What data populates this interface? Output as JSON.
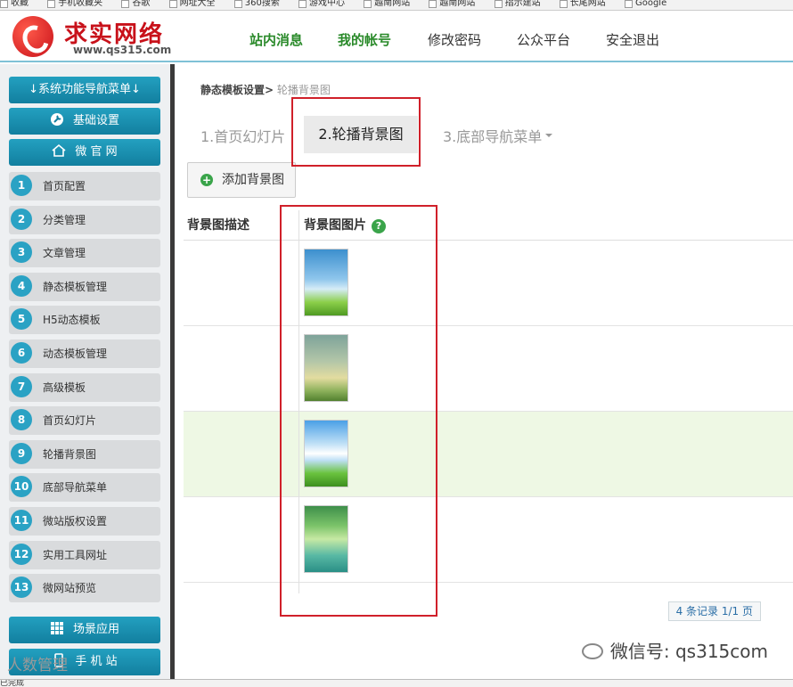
{
  "bookmarks": [
    "收藏",
    "手机收藏夹",
    "谷歌",
    "网址大全",
    "360搜索",
    "游戏中心",
    "越南网站",
    "越南网站",
    "指示建站",
    "长尾网站",
    "Google"
  ],
  "logo": {
    "name": "求实网络",
    "url": "www.qs315.com"
  },
  "topnav": [
    "站内消息",
    "我的帐号",
    "修改密码",
    "公众平台",
    "安全退出"
  ],
  "sidebar": {
    "menu_toggle": "↓系统功能导航菜单↓",
    "basic": "基础设置",
    "weiguanwang": "微 官 网",
    "items": [
      {
        "num": "1",
        "label": "首页配置"
      },
      {
        "num": "2",
        "label": "分类管理"
      },
      {
        "num": "3",
        "label": "文章管理"
      },
      {
        "num": "4",
        "label": "静态模板管理"
      },
      {
        "num": "5",
        "label": "H5动态模板"
      },
      {
        "num": "6",
        "label": "动态模板管理"
      },
      {
        "num": "7",
        "label": "高级模板"
      },
      {
        "num": "8",
        "label": "首页幻灯片"
      },
      {
        "num": "9",
        "label": "轮播背景图"
      },
      {
        "num": "10",
        "label": "底部导航菜单"
      },
      {
        "num": "11",
        "label": "微站版权设置"
      },
      {
        "num": "12",
        "label": "实用工具网址"
      },
      {
        "num": "13",
        "label": "微网站预览"
      }
    ],
    "scene": "场景应用",
    "mobile": "手 机 站"
  },
  "breadcrumb": {
    "parent": "静态模板设置>",
    "current": "轮播背景图"
  },
  "tabs": [
    "1.首页幻灯片",
    "2.轮播背景图",
    "3.底部导航菜单"
  ],
  "add_button": "添加背景图",
  "table": {
    "columns": [
      "背景图描述",
      "背景图图片"
    ],
    "rows": [
      {
        "desc": "",
        "image": "dandelion-sky"
      },
      {
        "desc": "",
        "image": "hot-air-balloon"
      },
      {
        "desc": "",
        "image": "heart-cloud-house"
      },
      {
        "desc": "",
        "image": "green-leaves"
      }
    ]
  },
  "pager": "4 条记录 1/1 页",
  "watermark": "微信号: qs315com",
  "watermark2": "人数管理",
  "statusbar": "已完成"
}
